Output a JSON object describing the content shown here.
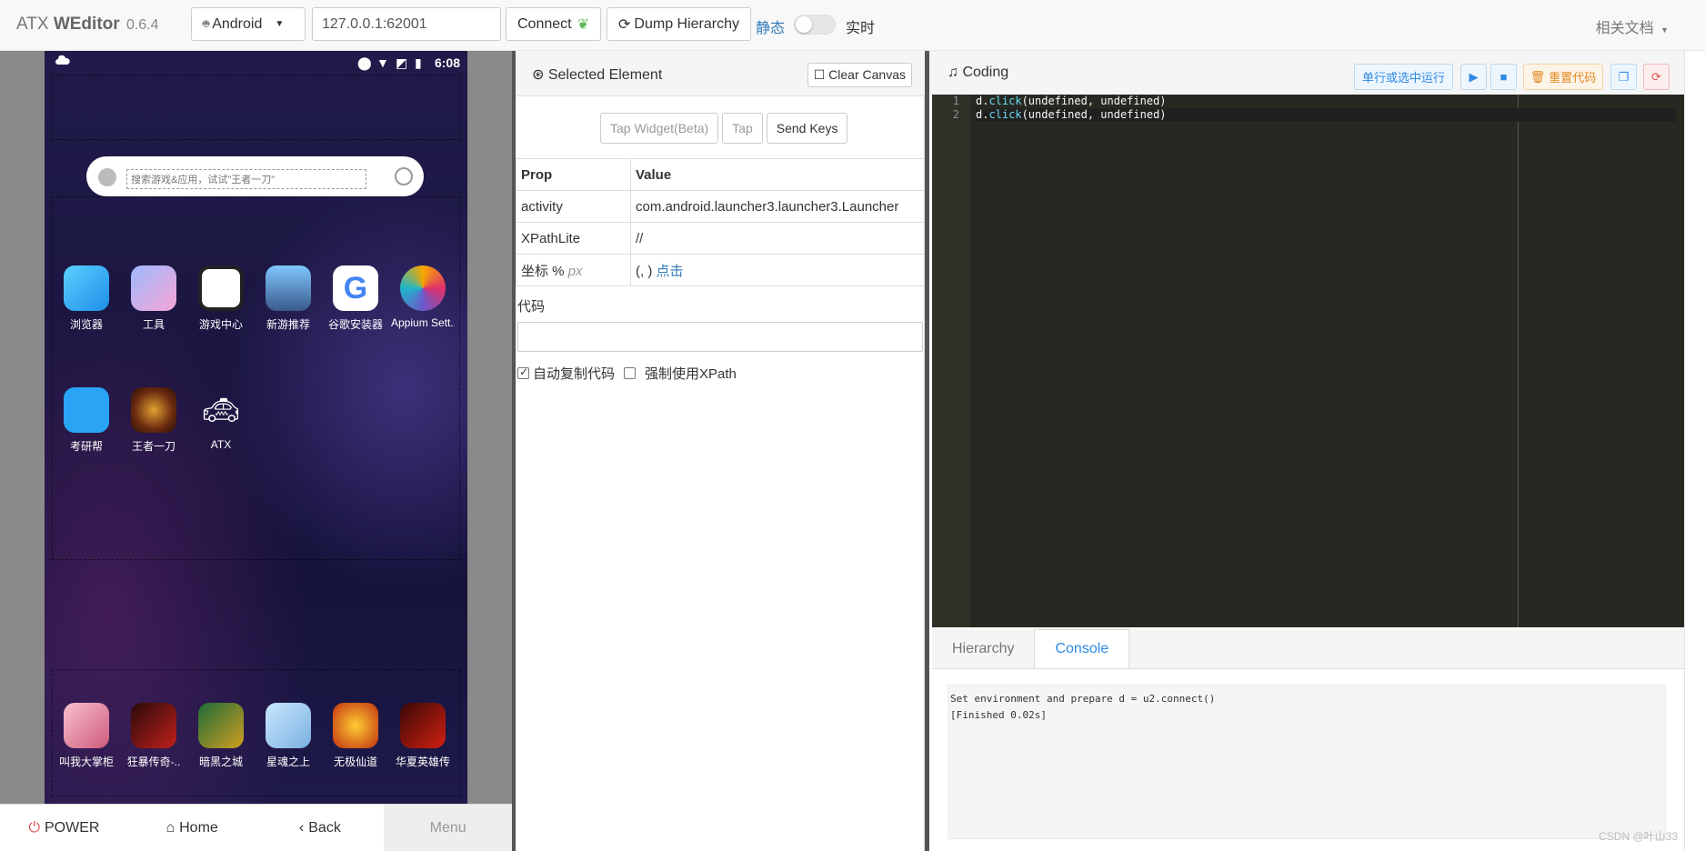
{
  "navbar": {
    "brand": "ATX",
    "brand_bold": "WEditor",
    "version": "0.6.4",
    "platform": "Android",
    "address": "127.0.0.1:62001",
    "connect": "Connect",
    "dump": "Dump Hierarchy",
    "mode_static": "静态",
    "mode_live": "实时",
    "docs": "相关文档"
  },
  "phone": {
    "time": "6:08",
    "search_placeholder": "搜索游戏&应用，试试\"王者一刀\"",
    "row1": [
      "浏览器",
      "工具",
      "游戏中心",
      "新游推荐",
      "谷歌安装器",
      "Appium Sett.."
    ],
    "row2": [
      "考研帮",
      "王者一刀",
      "ATX"
    ],
    "dock": [
      "叫我大掌柜",
      "狂暴传奇-..",
      "暗黑之城",
      "星魂之上",
      "无极仙道",
      "华夏英雄传"
    ]
  },
  "device_nav": {
    "power": "POWER",
    "home": "Home",
    "back": "Back",
    "menu": "Menu"
  },
  "selected": {
    "title": "Selected Element",
    "clear_canvas": "Clear Canvas",
    "tap_widget": "Tap Widget(Beta)",
    "tap": "Tap",
    "send_keys": "Send Keys",
    "th_prop": "Prop",
    "th_value": "Value",
    "rows": [
      {
        "prop": "activity",
        "value": "com.android.launcher3.launcher3.Launcher"
      },
      {
        "prop": "XPathLite",
        "value": "//"
      },
      {
        "prop": "坐标 %",
        "unit": "px",
        "value": "(, )",
        "link": "点击"
      }
    ],
    "code_label": "代码",
    "auto_copy": "自动复制代码",
    "force_xpath": "强制使用XPath"
  },
  "coding": {
    "title": "Coding",
    "run_selected": "单行或选中运行",
    "reset_code": "重置代码",
    "lines": [
      {
        "n": "1",
        "obj": "d.",
        "fn": "click",
        "args": "(undefined, undefined)"
      },
      {
        "n": "2",
        "obj": "d.",
        "fn": "click",
        "args": "(undefined, undefined)"
      }
    ],
    "tab_hierarchy": "Hierarchy",
    "tab_console": "Console",
    "console_lines": [
      "Set environment and prepare d = u2.connect()",
      "[Finished 0.02s]"
    ]
  },
  "watermark": "CSDN @叶山33",
  "colors": {
    "accent": "#2e8ae6",
    "editor_bg": "#272822",
    "danger": "#d9534f",
    "warn": "#e08a1e"
  }
}
